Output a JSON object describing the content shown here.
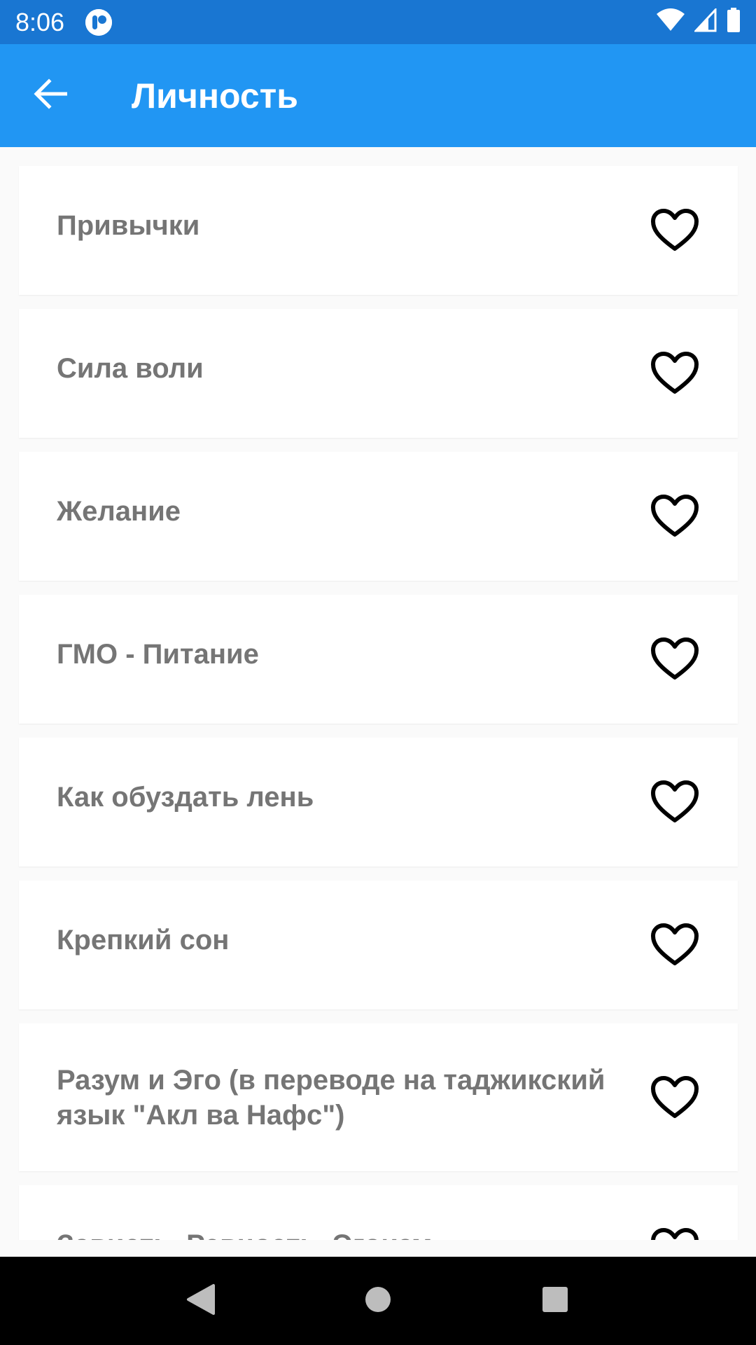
{
  "status_bar": {
    "time": "8:06"
  },
  "app_bar": {
    "title": "Личность"
  },
  "items": [
    {
      "label": "Привычки"
    },
    {
      "label": "Сила воли"
    },
    {
      "label": "Желание"
    },
    {
      "label": "ГМО - Питание"
    },
    {
      "label": "Как обуздать лень"
    },
    {
      "label": "Крепкий сон"
    },
    {
      "label": "Разум и Эго (в переводе на таджикский язык \"Акл ва Нафс\")"
    },
    {
      "label": "Зависть, Ревность, Эгоизм"
    }
  ],
  "colors": {
    "status_bar": "#1976d2",
    "app_bar": "#2196f3",
    "background": "#fafafa",
    "label_text": "#757575"
  },
  "icons": {
    "back": "arrow-left-icon",
    "favorite": "heart-outline-icon",
    "nav_back": "triangle-back-icon",
    "nav_home": "circle-home-icon",
    "nav_recents": "square-recents-icon"
  }
}
